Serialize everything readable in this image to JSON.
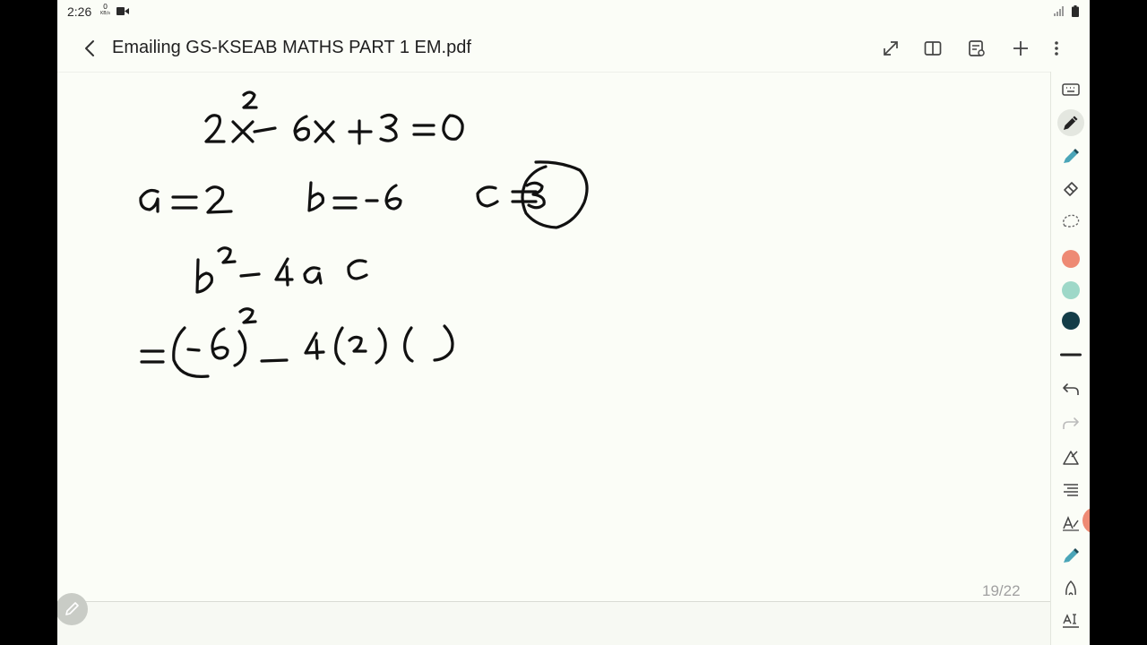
{
  "status_bar": {
    "time": "2:26",
    "net_speed_value": "0",
    "net_speed_unit": "KB/s",
    "icons": [
      "video-icon",
      "signal-icon",
      "battery-icon"
    ]
  },
  "title_bar": {
    "title": "Emailing GS-KSEAB MATHS PART 1 EM.pdf",
    "buttons": [
      "back-icon",
      "fullscreen-icon",
      "book-view-icon",
      "page-settings-icon",
      "add-icon",
      "more-icon"
    ]
  },
  "canvas": {
    "handwriting_lines": [
      "2x² - 6x + 3 = 0",
      "a = 2    b = -6    c = 3",
      "b² - 4ac",
      "= (-6)² - 4(2)( )"
    ],
    "page_indicator": "19/22"
  },
  "tool_panel": {
    "tools": [
      "keyboard-icon",
      "pen-icon",
      "highlighter-icon",
      "eraser-icon",
      "lasso-icon"
    ],
    "colors": [
      "#ee8a74",
      "#9ed8c8",
      "#143d48"
    ],
    "tools2": [
      "stroke-width-icon",
      "undo-icon",
      "redo-icon",
      "shape-icon",
      "text-align-icon",
      "text-style-icon",
      "highlighter-pen-icon",
      "pencil-tip-icon",
      "text-recognition-icon"
    ]
  },
  "colors": {
    "background": "#fbfdf7",
    "ink": "#111111",
    "active_color": "#ee8a74"
  }
}
